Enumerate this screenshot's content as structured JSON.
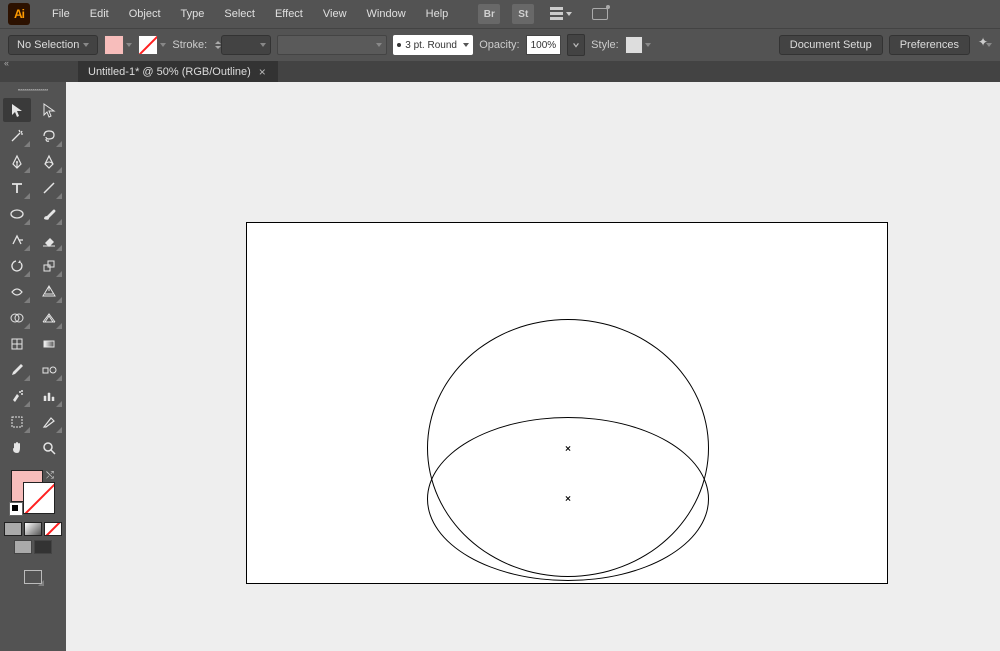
{
  "app": {
    "logo_text": "Ai"
  },
  "menu": {
    "items": [
      "File",
      "Edit",
      "Object",
      "Type",
      "Select",
      "Effect",
      "View",
      "Window",
      "Help"
    ],
    "br_label": "Br",
    "st_label": "St"
  },
  "control": {
    "selection_label": "No Selection",
    "stroke_label": "Stroke:",
    "brush_label": "3 pt. Round",
    "opacity_label": "Opacity:",
    "opacity_value": "100%",
    "style_label": "Style:",
    "doc_setup": "Document Setup",
    "preferences": "Preferences",
    "fill_color": "#f7bdbb"
  },
  "tabs": {
    "active": {
      "title": "Untitled-1* @ 50% (RGB/Outline)",
      "close": "×"
    }
  },
  "tools": {
    "row_names": [
      [
        "selection-tool",
        "direct-selection-tool"
      ],
      [
        "magic-wand-tool",
        "lasso-tool"
      ],
      [
        "pen-tool",
        "curvature-tool"
      ],
      [
        "type-tool",
        "line-segment-tool"
      ],
      [
        "ellipse-tool",
        "paintbrush-tool"
      ],
      [
        "shaper-tool",
        "eraser-tool"
      ],
      [
        "rotate-tool",
        "scale-tool"
      ],
      [
        "width-tool",
        "free-transform-tool"
      ],
      [
        "shape-builder-tool",
        "perspective-grid-tool"
      ],
      [
        "mesh-tool",
        "gradient-tool"
      ],
      [
        "eyedropper-tool",
        "blend-tool"
      ],
      [
        "symbol-sprayer-tool",
        "column-graph-tool"
      ],
      [
        "artboard-tool",
        "slice-tool"
      ],
      [
        "hand-tool",
        "zoom-tool"
      ]
    ]
  },
  "canvas": {
    "shapes": {
      "circle_label": "circle-path",
      "ellipse_label": "ellipse-path",
      "center1": "shape-center-1",
      "center2": "shape-center-2"
    }
  }
}
